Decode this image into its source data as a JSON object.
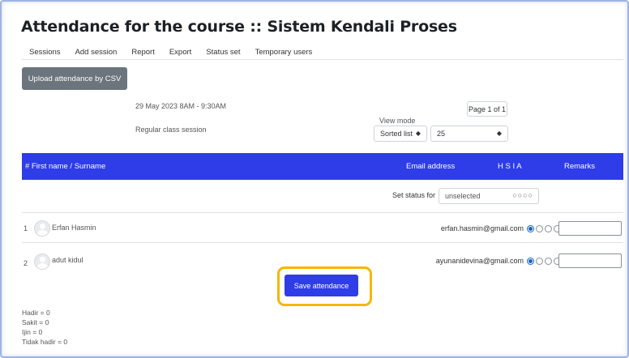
{
  "page": {
    "title": "Attendance for the course :: Sistem Kendali Proses",
    "tabs": [
      "Sessions",
      "Add session",
      "Report",
      "Export",
      "Status set",
      "Temporary users"
    ]
  },
  "toolbar": {
    "upload_label": "Upload attendance by CSV"
  },
  "session": {
    "date": "29 May 2023 8AM - 9:30AM",
    "description": "Regular class session"
  },
  "pager": {
    "label": "Page 1 of 1"
  },
  "view_mode": {
    "label": "View mode",
    "sort_value": "Sorted list",
    "per_page_value": "25"
  },
  "table": {
    "headers": {
      "num_name": "#  First name / Surname",
      "email": "Email address",
      "statuses": "H   S   I   A",
      "remarks": "Remarks"
    },
    "set_status": {
      "label": "Set status for",
      "value": "unselected"
    },
    "rows": [
      {
        "num": "1",
        "name": "Erfan Hasmin",
        "email": "erfan.hasmin@gmail.com",
        "selected_status": "H",
        "remarks": ""
      },
      {
        "num": "2",
        "name": "adut kidul",
        "email": "ayunanidevina@gmail.com",
        "selected_status": "H",
        "remarks": ""
      }
    ]
  },
  "actions": {
    "save_label": "Save attendance"
  },
  "summary": {
    "hadir": "Hadir = 0",
    "sakit": "Sakit = 0",
    "ijin": "Ijin = 0",
    "tidak_hadir": "Tidak hadir = 0"
  },
  "colors": {
    "primary": "#2e3de8",
    "secondary": "#6c757d",
    "highlight": "#f5b700",
    "radio_checked": "#1565c0"
  }
}
